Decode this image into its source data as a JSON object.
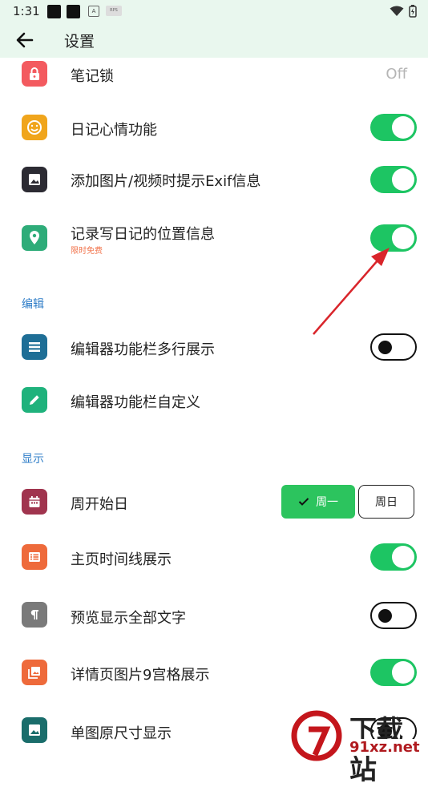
{
  "status_bar": {
    "time": "1:31",
    "mini_icon_a": "A",
    "mini_icon_b": "RPS"
  },
  "app_bar": {
    "title": "设置",
    "back_icon": "arrow-left-icon"
  },
  "settings": {
    "note_lock": {
      "label": "笔记锁",
      "value": "Off",
      "icon": "lock-icon",
      "icon_color": "#f35a5f"
    },
    "diary_mood": {
      "label": "日记心情功能",
      "enabled": true,
      "icon": "smile-icon",
      "icon_color": "#f0a51c"
    },
    "exif_hint": {
      "label": "添加图片/视频时提示Exif信息",
      "enabled": true,
      "icon": "image-icon",
      "icon_color": "#2c2b33"
    },
    "location": {
      "label": "记录写日记的位置信息",
      "sublabel": "限时免费",
      "enabled": true,
      "icon": "location-pin-icon",
      "icon_color": "#2eac79"
    }
  },
  "section_edit": {
    "header": "编辑",
    "multiline_toolbar": {
      "label": "编辑器功能栏多行展示",
      "enabled": false,
      "icon": "menu-lines-icon",
      "icon_color": "#1e6e96"
    },
    "custom_toolbar": {
      "label": "编辑器功能栏自定义",
      "icon": "pencil-icon",
      "icon_color": "#1fb27c"
    }
  },
  "section_display": {
    "header": "显示",
    "week_start": {
      "label": "周开始日",
      "icon": "calendar-icon",
      "icon_color": "#a0344e",
      "options": [
        "周一",
        "周日"
      ],
      "selected": "周一"
    },
    "timeline": {
      "label": "主页时间线展示",
      "enabled": true,
      "icon": "list-icon",
      "icon_color": "#ee6a3b"
    },
    "full_text": {
      "label": "预览显示全部文字",
      "enabled": false,
      "icon": "paragraph-icon",
      "icon_color": "#7a7a7a"
    },
    "grid9": {
      "label": "详情页图片9宫格展示",
      "enabled": true,
      "icon": "gallery-icon",
      "icon_color": "#ee6a3b"
    },
    "original_size": {
      "label": "单图原尺寸显示",
      "enabled": false,
      "icon": "photo-icon",
      "icon_color": "#1a6d6b"
    }
  },
  "colors": {
    "accent_green": "#1dc563",
    "section_blue": "#2d7cc7",
    "annotation_red": "#d9252b",
    "appbar_bg": "#e9f7ee"
  },
  "watermark": {
    "logo_text": "下载站",
    "url": "91xz.net"
  }
}
